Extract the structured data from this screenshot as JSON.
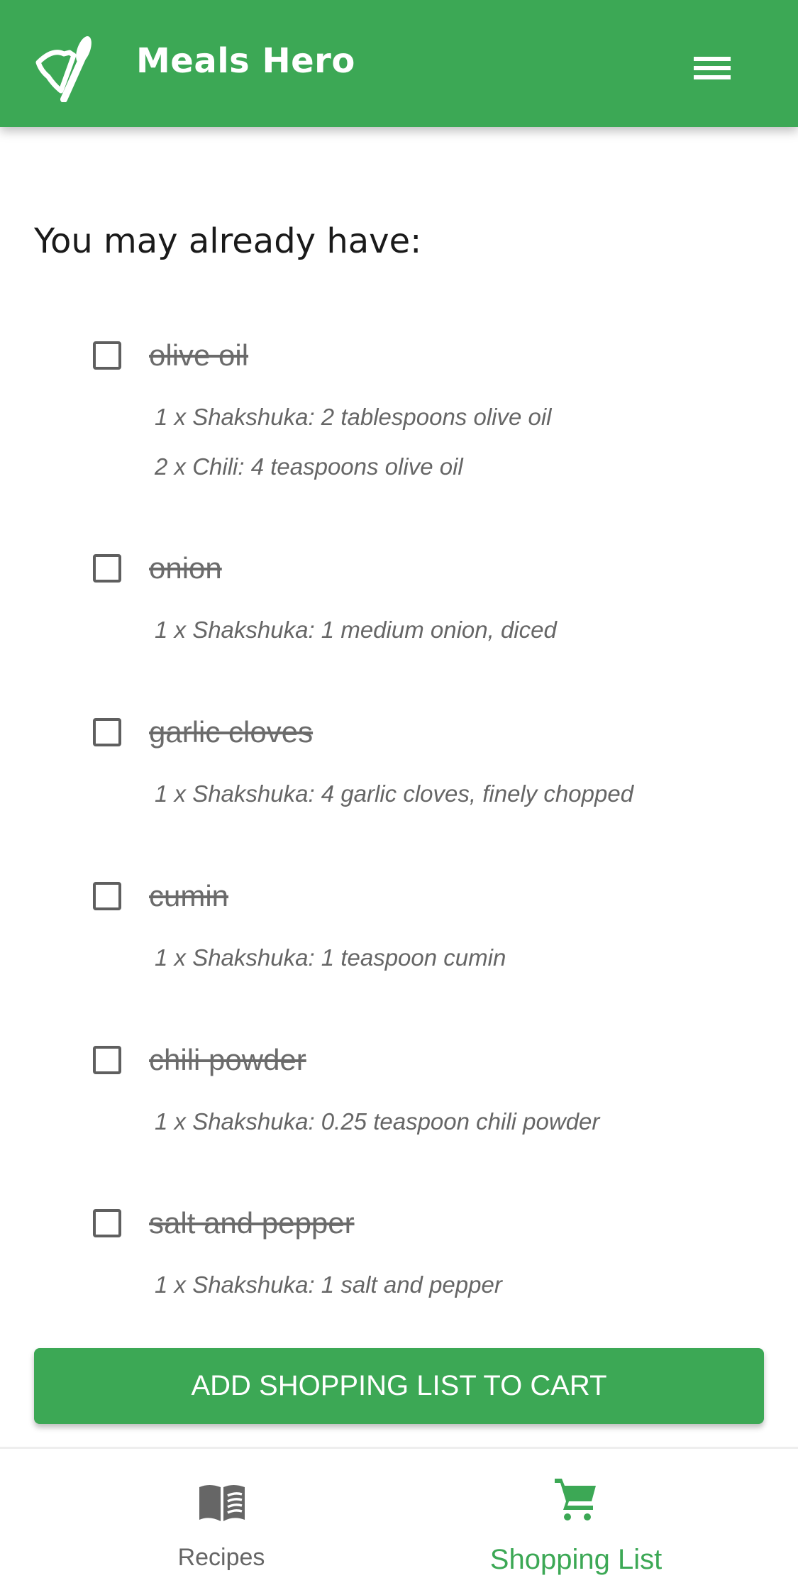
{
  "header": {
    "title": "Meals Hero",
    "menu_icon": "hamburger-menu-icon",
    "logo_icon": "bell-spoon-logo"
  },
  "section": {
    "heading": "You may already have:"
  },
  "items": [
    {
      "label": "olive oil",
      "checked": false,
      "details": [
        "1 x Shakshuka: 2 tablespoons olive oil",
        "2 x Chili: 4 teaspoons olive oil"
      ]
    },
    {
      "label": "onion",
      "checked": false,
      "details": [
        "1 x Shakshuka: 1 medium onion, diced"
      ]
    },
    {
      "label": "garlic cloves",
      "checked": false,
      "details": [
        "1 x Shakshuka: 4 garlic cloves, finely chopped"
      ]
    },
    {
      "label": "cumin",
      "checked": false,
      "details": [
        "1 x Shakshuka: 1 teaspoon cumin"
      ]
    },
    {
      "label": "chili powder",
      "checked": false,
      "details": [
        "1 x Shakshuka: 0.25 teaspoon chili powder"
      ]
    },
    {
      "label": "salt and pepper",
      "checked": false,
      "details": [
        "1 x Shakshuka: 1 salt and pepper"
      ]
    }
  ],
  "cta": {
    "label": "ADD SHOPPING LIST TO CART"
  },
  "bottom_nav": {
    "items": [
      {
        "label": "Recipes",
        "icon": "book-icon",
        "active": false
      },
      {
        "label": "Shopping List",
        "icon": "cart-icon",
        "active": true
      }
    ]
  },
  "colors": {
    "brand": "#3ca855",
    "inactive": "#666666"
  }
}
